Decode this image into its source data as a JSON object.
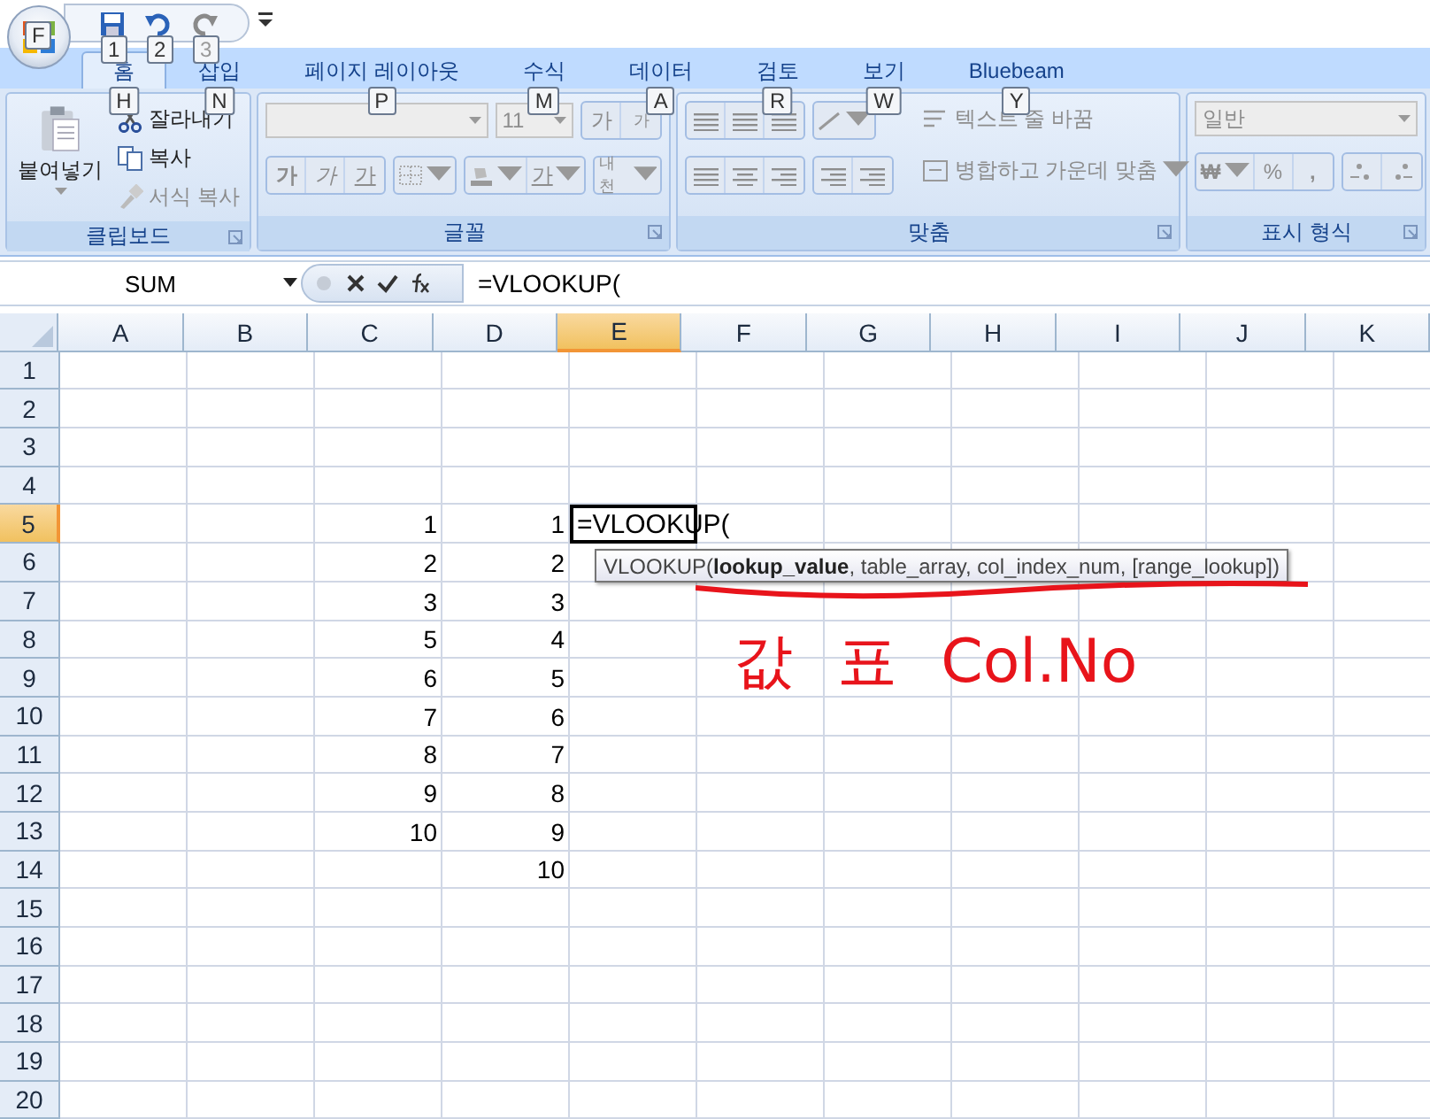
{
  "office_button": {
    "keytip": "F"
  },
  "quick_access": [
    {
      "kind": "save",
      "keytip": "1",
      "disabled": false
    },
    {
      "kind": "undo",
      "keytip": "2",
      "disabled": false
    },
    {
      "kind": "redo",
      "keytip": "3",
      "disabled": true
    }
  ],
  "tabs": [
    {
      "label": "홈",
      "keytip": "H",
      "selected": true
    },
    {
      "label": "삽입",
      "keytip": "N",
      "selected": false
    },
    {
      "label": "페이지 레이아웃",
      "keytip": "P",
      "selected": false
    },
    {
      "label": "수식",
      "keytip": "M",
      "selected": false
    },
    {
      "label": "데이터",
      "keytip": "A",
      "selected": false
    },
    {
      "label": "검토",
      "keytip": "R",
      "selected": false
    },
    {
      "label": "보기",
      "keytip": "W",
      "selected": false
    },
    {
      "label": "Bluebeam",
      "keytip": "Y",
      "selected": false
    }
  ],
  "ribbon": {
    "clipboard": {
      "title": "클립보드",
      "paste": "붙여넣기",
      "cut": "잘라내기",
      "copy": "복사",
      "format_painter": {
        "label": "서식 복사",
        "disabled": true
      }
    },
    "font": {
      "title": "글꼴",
      "disabled": true,
      "font_size": "11",
      "grow": "가",
      "shrink": "가",
      "bold": "가",
      "italic": "가",
      "underline": "가",
      "font_color": "가",
      "phonetic": "내천"
    },
    "alignment": {
      "title": "맞춤",
      "disabled": true,
      "wrap_text": "텍스트 줄 바꿈",
      "merge_center": "병합하고 가운데 맞춤"
    },
    "number": {
      "title": "표시 형식",
      "disabled": true,
      "format": "일반",
      "currency": "₩",
      "percent": "%",
      "comma": ","
    }
  },
  "formula_bar": {
    "name_box": "SUM",
    "formula": "=VLOOKUP("
  },
  "columns": [
    {
      "label": "A",
      "selected": false
    },
    {
      "label": "B",
      "selected": false
    },
    {
      "label": "C",
      "selected": false
    },
    {
      "label": "D",
      "selected": false
    },
    {
      "label": "E",
      "selected": true
    },
    {
      "label": "F",
      "selected": false
    },
    {
      "label": "G",
      "selected": false
    },
    {
      "label": "H",
      "selected": false
    },
    {
      "label": "I",
      "selected": false
    },
    {
      "label": "J",
      "selected": false
    },
    {
      "label": "K",
      "selected": false
    }
  ],
  "rows": [
    {
      "label": "1",
      "selected": false,
      "cells": {}
    },
    {
      "label": "2",
      "selected": false,
      "cells": {}
    },
    {
      "label": "3",
      "selected": false,
      "cells": {}
    },
    {
      "label": "4",
      "selected": false,
      "cells": {}
    },
    {
      "label": "5",
      "selected": true,
      "cells": {
        "c": "1",
        "d": "1",
        "e": "=VLOOKUP("
      }
    },
    {
      "label": "6",
      "selected": false,
      "cells": {
        "c": "2",
        "d": "2"
      }
    },
    {
      "label": "7",
      "selected": false,
      "cells": {
        "c": "3",
        "d": "3"
      }
    },
    {
      "label": "8",
      "selected": false,
      "cells": {
        "c": "5",
        "d": "4"
      }
    },
    {
      "label": "9",
      "selected": false,
      "cells": {
        "c": "6",
        "d": "5"
      }
    },
    {
      "label": "10",
      "selected": false,
      "cells": {
        "c": "7",
        "d": "6"
      }
    },
    {
      "label": "11",
      "selected": false,
      "cells": {
        "c": "8",
        "d": "7"
      }
    },
    {
      "label": "12",
      "selected": false,
      "cells": {
        "c": "9",
        "d": "8"
      }
    },
    {
      "label": "13",
      "selected": false,
      "cells": {
        "c": "10",
        "d": "9"
      }
    },
    {
      "label": "14",
      "selected": false,
      "cells": {
        "d": "10"
      }
    },
    {
      "label": "15",
      "selected": false,
      "cells": {}
    },
    {
      "label": "16",
      "selected": false,
      "cells": {}
    },
    {
      "label": "17",
      "selected": false,
      "cells": {}
    },
    {
      "label": "18",
      "selected": false,
      "cells": {}
    },
    {
      "label": "19",
      "selected": false,
      "cells": {}
    },
    {
      "label": "20",
      "selected": false,
      "cells": {}
    }
  ],
  "tooltip": {
    "text": "VLOOKUP(**lookup_value**, table_array, col_index_num, [range_lookup])"
  },
  "annotation": {
    "text": "값 표 Col.No"
  }
}
